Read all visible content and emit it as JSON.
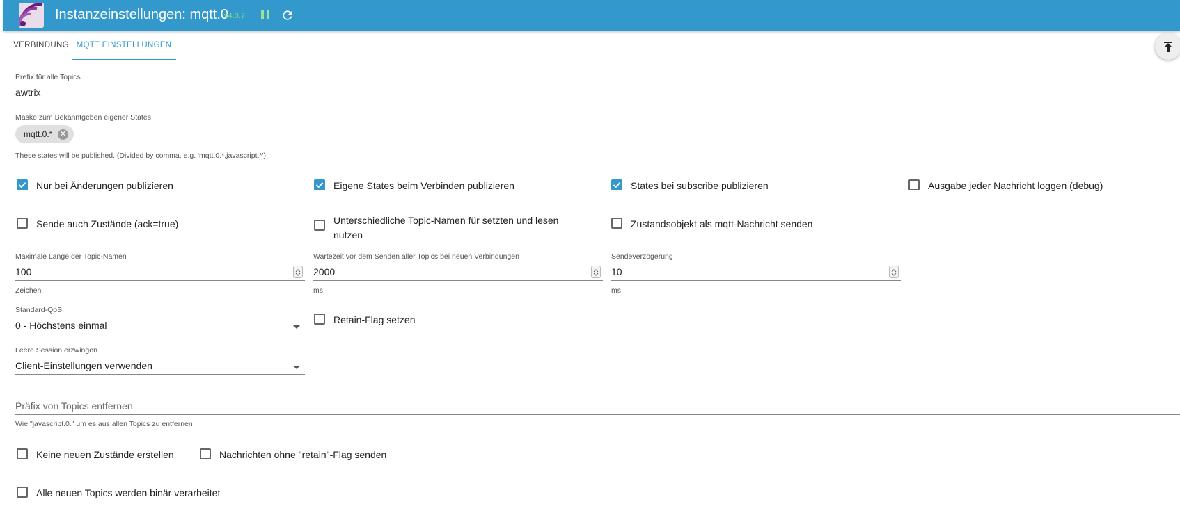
{
  "header": {
    "title": "Instanzeinstellungen: mqtt.0",
    "version": "v4.0.7",
    "pause_icon": "pause-icon",
    "reload_icon": "reload-icon",
    "color": "#3399cc"
  },
  "tabs": [
    {
      "label": "VERBINDUNG",
      "active": false
    },
    {
      "label": "MQTT EINSTELLUNGEN",
      "active": true
    }
  ],
  "fab_icon": "scroll-to-top-icon",
  "form": {
    "prefix": {
      "label": "Prefix für alle Topics",
      "value": "awtrix"
    },
    "mask": {
      "label": "Maske zum Bekanntgeben eigener States",
      "chip": "mqtt.0.*",
      "helper": "These states will be published. (Divided by comma, e.g. 'mqtt.0.*,javascript.*')"
    },
    "checkboxes": {
      "only_changes": {
        "label": "Nur bei Änderungen publizieren",
        "checked": true
      },
      "own_states_connect": {
        "label": "Eigene States beim Verbinden publizieren",
        "checked": true
      },
      "states_subscribe": {
        "label": "States bei subscribe publizieren",
        "checked": true
      },
      "log_debug": {
        "label": "Ausgabe jeder Nachricht loggen (debug)",
        "checked": false
      },
      "send_ack": {
        "label": "Sende auch Zustände (ack=true)",
        "checked": false
      },
      "different_topics": {
        "label": "Unterschiedliche Topic-Namen für setzten und lesen nutzen",
        "checked": false
      },
      "state_object": {
        "label": "Zustandsobjekt als mqtt-Nachricht senden",
        "checked": false
      },
      "retain_flag": {
        "label": "Retain-Flag setzen",
        "checked": false
      },
      "no_new_states": {
        "label": "Keine neuen Zustände erstellen",
        "checked": false
      },
      "no_retain": {
        "label": "Nachrichten ohne \"retain\"-Flag senden",
        "checked": false
      },
      "binary": {
        "label": "Alle neuen Topics werden binär verarbeitet",
        "checked": false
      }
    },
    "max_topic_length": {
      "label": "Maximale Länge der Topic-Namen",
      "value": "100",
      "unit": "Zeichen"
    },
    "wait_time": {
      "label": "Wartezeit vor dem Senden aller Topics bei neuen Verbindungen",
      "value": "2000",
      "unit": "ms"
    },
    "send_delay": {
      "label": "Sendeverzögerung",
      "value": "10",
      "unit": "ms"
    },
    "qos": {
      "label": "Standard-QoS:",
      "value": "0 - Höchstens einmal"
    },
    "clean_session": {
      "label": "Leere Session erzwingen",
      "value": "Client-Einstellungen verwenden"
    },
    "remove_prefix": {
      "placeholder": "Präfix von Topics entfernen",
      "helper": "Wie \"javascript.0.\" um es aus allen Topics zu entfernen"
    }
  }
}
